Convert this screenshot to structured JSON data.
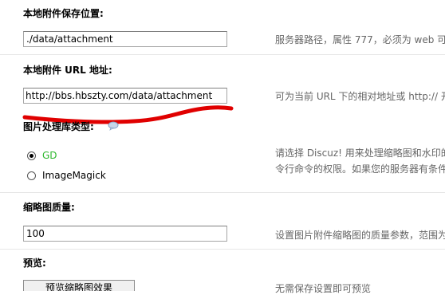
{
  "colors": {
    "accent_green": "#2eb82e",
    "annotation_red": "#e00000",
    "hint_text": "#666666"
  },
  "settings": [
    {
      "label": "本地附件保存位置:",
      "value": "./data/attachment",
      "hint": "服务器路径，属性 777，必须为 web 可"
    },
    {
      "label": "本地附件 URL 地址:",
      "value": "http://bbs.hbszty.com/data/attachment",
      "hint": "可为当前 URL 下的相对地址或 http:// 开"
    },
    {
      "label": "图片处理库类型:",
      "help_icon": "help-bubble-icon",
      "options": [
        {
          "label": "GD",
          "checked": true
        },
        {
          "label": "ImageMagick",
          "checked": false
        }
      ],
      "hint_line1": "请选择 Discuz! 用来处理缩略图和水印的",
      "hint_line2": "令行命令的权限。如果您的服务器有条件"
    },
    {
      "label": "缩略图质量:",
      "value": "100",
      "hint": "设置图片附件缩略图的质量参数，范围为"
    },
    {
      "label": "预览:",
      "button_label": "预览缩略图效果",
      "hint": "无需保存设置即可预览"
    }
  ]
}
